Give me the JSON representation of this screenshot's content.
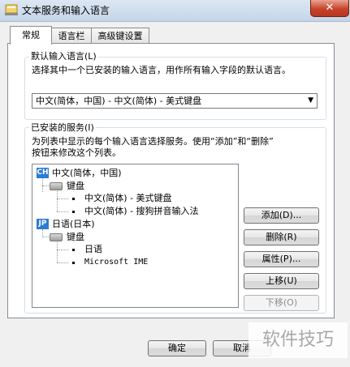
{
  "window": {
    "title": "文本服务和输入语言",
    "close_glyph": "✕"
  },
  "tabs": [
    {
      "label": "常规",
      "active": true
    },
    {
      "label": "语言栏",
      "active": false
    },
    {
      "label": "高级键设置",
      "active": false
    }
  ],
  "default_language": {
    "group_label": "默认输入语言(L)",
    "description": "选择其中一个已安装的输入语言，用作所有输入字段的默认语言。",
    "selected": "中文(简体，中国) - 中文(简体) - 美式键盘"
  },
  "installed_services": {
    "group_label": "已安装的服务(I)",
    "description_line1": "为列表中显示的每个输入语言选择服务。使用“添加”和“删除”",
    "description_line2": "按钮来修改这个列表。",
    "tree": {
      "lang1": {
        "badge": "CH",
        "name": "中文(简体，中国)",
        "keyboard": "键盘",
        "items": [
          "中文(简体) - 美式键盘",
          "中文(简体) - 搜狗拼音输入法"
        ]
      },
      "lang2": {
        "badge": "JP",
        "name": "日语(日本)",
        "keyboard": "键盘",
        "items": [
          "日语",
          "Microsoft IME"
        ]
      }
    },
    "buttons": {
      "add": "添加(D)...",
      "remove": "删除(R)",
      "properties": "属性(P)...",
      "move_up": "上移(U)",
      "move_down": "下移(O)"
    }
  },
  "footer": {
    "ok": "确定",
    "cancel_partial": "取消"
  },
  "watermark": "软件技巧",
  "colors": {
    "accent_badge": "#2c7bd6",
    "close_button": "#c7432a"
  }
}
